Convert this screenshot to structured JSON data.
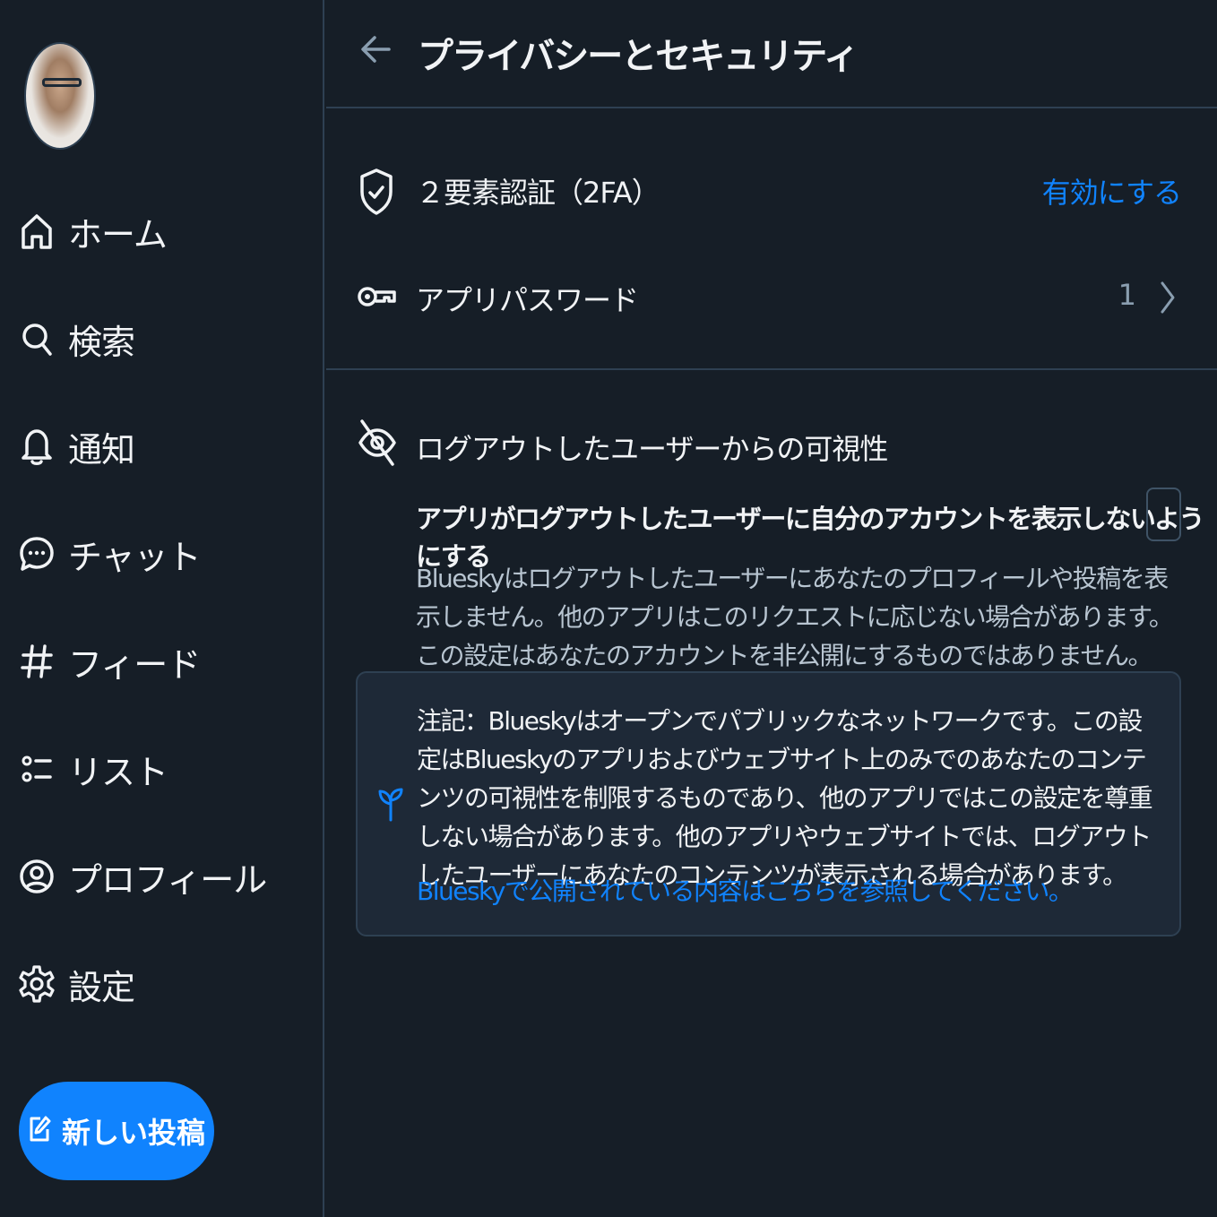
{
  "sidebar": {
    "nav": [
      {
        "label": "ホーム",
        "icon": "home-icon"
      },
      {
        "label": "検索",
        "icon": "search-icon"
      },
      {
        "label": "通知",
        "icon": "bell-icon"
      },
      {
        "label": "チャット",
        "icon": "chat-icon"
      },
      {
        "label": "フィード",
        "icon": "hashtag-icon"
      },
      {
        "label": "リスト",
        "icon": "list-icon"
      },
      {
        "label": "プロフィール",
        "icon": "user-circle-icon"
      },
      {
        "label": "設定",
        "icon": "gear-icon"
      }
    ],
    "compose_label": "新しい投稿"
  },
  "header": {
    "title": "プライバシーとセキュリティ"
  },
  "security": {
    "two_factor": {
      "label": "２要素認証（2FA）",
      "action": "有効にする"
    },
    "app_passwords": {
      "label": "アプリパスワード",
      "count": "1"
    }
  },
  "visibility": {
    "title": "ログアウトしたユーザーからの可視性",
    "toggle_label": "アプリがログアウトしたユーザーに自分のアカウントを表示しないようにする",
    "toggle_checked": false,
    "description": "Blueskyはログアウトしたユーザーにあなたのプロフィールや投稿を表示しません。他のアプリはこのリクエストに応じない場合があります。この設定はあなたのアカウントを非公開にするものではありません。",
    "notice_text": "注記：Blueskyはオープンでパブリックなネットワークです。この設定はBlueskyのアプリおよびウェブサイト上のみでのあなたのコンテンツの可視性を制限するものであり、他のアプリではこの設定を尊重しない場合があります。他のアプリやウェブサイトでは、ログアウトしたユーザーにあなたのコンテンツが表示される場合があります。",
    "notice_link": "Blueskyで公開されている内容はこちらを参照してください。"
  },
  "colors": {
    "background": "#161e27",
    "accent": "#1083fe",
    "divider": "#2e4052",
    "notice_bg": "#1e2937"
  }
}
